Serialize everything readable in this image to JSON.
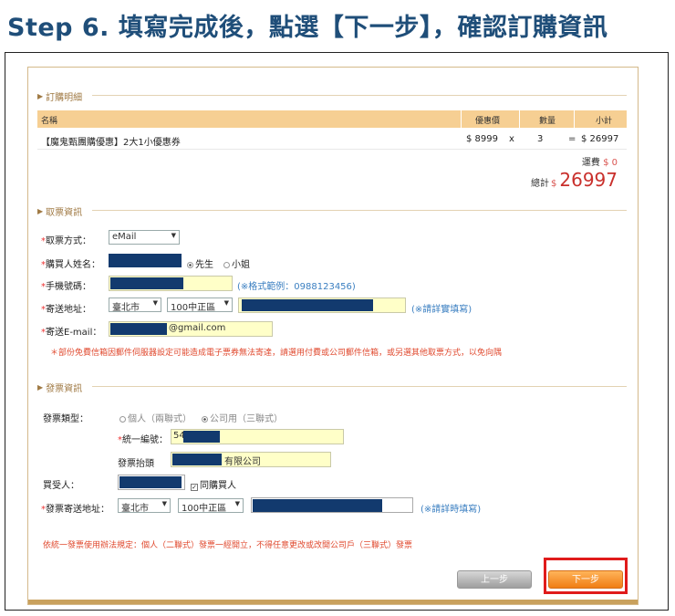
{
  "header": {
    "title": "Step 6. 填寫完成後，點選【下一步】，確認訂購資訊"
  },
  "order": {
    "section_title": "訂購明細",
    "columns": [
      "名稱",
      "優惠價",
      "數量",
      "小計"
    ],
    "item": {
      "name": "【魔鬼甄團購優惠】2大1小優惠券",
      "price": "$ 8999",
      "x": "x",
      "qty": "3",
      "eq": "=",
      "subtotal": "$ 26997"
    },
    "shipping_label": "運費",
    "shipping_value": "$ 0",
    "total_label": "總計",
    "total_currency": "$",
    "total_value": "26997"
  },
  "ticket": {
    "section_title": "取票資訊",
    "method_label": "取票方式：",
    "method_value": "eMail",
    "buyer_label": "購買人姓名：",
    "mr": "先生",
    "ms": "小姐",
    "phone_label": "手機號碼：",
    "phone_hint": "(※格式範例：0988123456)",
    "address_label": "寄送地址：",
    "city": "臺北市",
    "district": "100中正區",
    "address_hint": "(※請詳實填寫)",
    "email_label": "寄送E-mail：",
    "email_suffix": "@gmail.com",
    "warning": "＊部份免費信箱因郵件伺服器設定可能造成電子票券無法寄達，請選用付費或公司郵件信箱，或另選其他取票方式，以免向隅"
  },
  "invoice": {
    "section_title": "發票資訊",
    "type_label": "發票類型：",
    "personal": "個人（兩聯式）",
    "company": "公司用（三聯式）",
    "tax_id_label": "統一編號：",
    "tax_id_value": "54",
    "invoice_title_label": "發票抬頭",
    "invoice_title_suffix": "有限公司",
    "recipient_label": "買受人：",
    "same_as_buyer": "同購買人",
    "addr_label": "發票寄送地址：",
    "city": "臺北市",
    "district": "100中正區",
    "addr_hint": "(※請詳時填寫)",
    "notice": "依統一發票使用辦法規定：個人（二聯式）發票一經開立，不得任意更改或改開公司戶（三聯式）發票"
  },
  "buttons": {
    "prev": "上一步",
    "next": "下一步"
  }
}
